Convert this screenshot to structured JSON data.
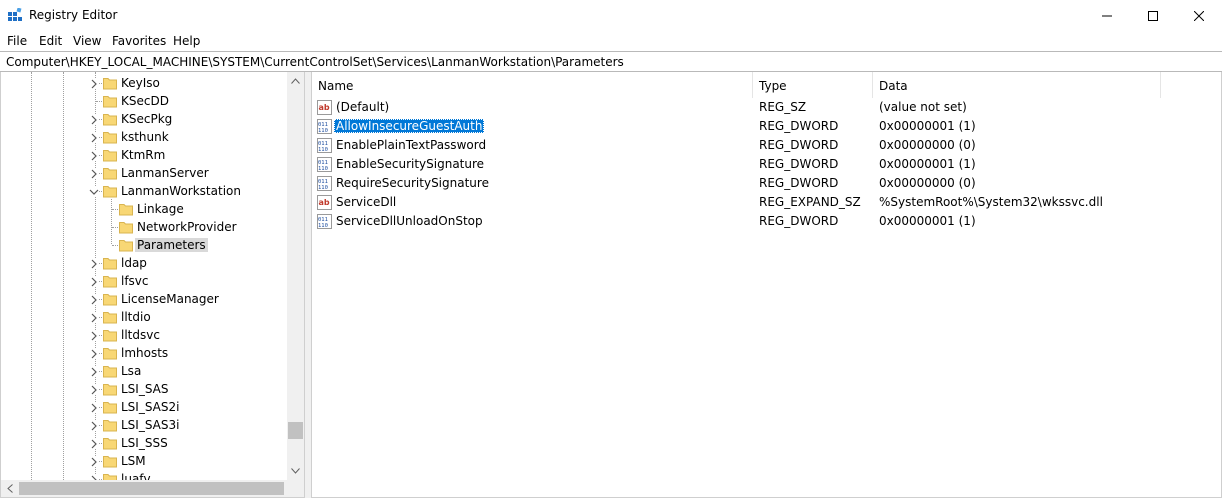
{
  "window": {
    "title": "Registry Editor",
    "controls": [
      "minimize",
      "maximize",
      "close"
    ]
  },
  "menu": [
    "File",
    "Edit",
    "View",
    "Favorites",
    "Help"
  ],
  "address": "Computer\\HKEY_LOCAL_MACHINE\\SYSTEM\\CurrentControlSet\\Services\\LanmanWorkstation\\Parameters",
  "tree": {
    "items": [
      {
        "label": "KeyIso",
        "expandable": true,
        "expanded": false
      },
      {
        "label": "KSecDD",
        "expandable": false
      },
      {
        "label": "KSecPkg",
        "expandable": true,
        "expanded": false
      },
      {
        "label": "ksthunk",
        "expandable": true,
        "expanded": false
      },
      {
        "label": "KtmRm",
        "expandable": true,
        "expanded": false
      },
      {
        "label": "LanmanServer",
        "expandable": true,
        "expanded": false
      },
      {
        "label": "LanmanWorkstation",
        "expandable": true,
        "expanded": true
      },
      {
        "label": "Linkage",
        "expandable": false,
        "child": true
      },
      {
        "label": "NetworkProvider",
        "expandable": false,
        "child": true
      },
      {
        "label": "Parameters",
        "expandable": false,
        "child": true,
        "selected": true
      },
      {
        "label": "ldap",
        "expandable": true,
        "expanded": false
      },
      {
        "label": "lfsvc",
        "expandable": true,
        "expanded": false
      },
      {
        "label": "LicenseManager",
        "expandable": true,
        "expanded": false
      },
      {
        "label": "lltdio",
        "expandable": true,
        "expanded": false
      },
      {
        "label": "lltdsvc",
        "expandable": true,
        "expanded": false
      },
      {
        "label": "lmhosts",
        "expandable": true,
        "expanded": false
      },
      {
        "label": "Lsa",
        "expandable": true,
        "expanded": false
      },
      {
        "label": "LSI_SAS",
        "expandable": true,
        "expanded": false
      },
      {
        "label": "LSI_SAS2i",
        "expandable": true,
        "expanded": false
      },
      {
        "label": "LSI_SAS3i",
        "expandable": true,
        "expanded": false
      },
      {
        "label": "LSI_SSS",
        "expandable": true,
        "expanded": false
      },
      {
        "label": "LSM",
        "expandable": true,
        "expanded": false
      },
      {
        "label": "luafv",
        "expandable": true,
        "expanded": false
      }
    ]
  },
  "columns": {
    "name": "Name",
    "type": "Type",
    "data": "Data"
  },
  "values": [
    {
      "name": "(Default)",
      "type": "REG_SZ",
      "data": "(value not set)",
      "icon": "string-value-icon"
    },
    {
      "name": "AllowInsecureGuestAuth",
      "type": "REG_DWORD",
      "data": "0x00000001 (1)",
      "icon": "binary-value-icon",
      "selected": true
    },
    {
      "name": "EnablePlainTextPassword",
      "type": "REG_DWORD",
      "data": "0x00000000 (0)",
      "icon": "binary-value-icon"
    },
    {
      "name": "EnableSecuritySignature",
      "type": "REG_DWORD",
      "data": "0x00000001 (1)",
      "icon": "binary-value-icon"
    },
    {
      "name": "RequireSecuritySignature",
      "type": "REG_DWORD",
      "data": "0x00000000 (0)",
      "icon": "binary-value-icon"
    },
    {
      "name": "ServiceDll",
      "type": "REG_EXPAND_SZ",
      "data": "%SystemRoot%\\System32\\wkssvc.dll",
      "icon": "string-value-icon"
    },
    {
      "name": "ServiceDllUnloadOnStop",
      "type": "REG_DWORD",
      "data": "0x00000001 (1)",
      "icon": "binary-value-icon"
    }
  ],
  "colors": {
    "selection": "#0078d7",
    "tree_selection": "#d9d9d9",
    "folder": "#f8d775"
  }
}
